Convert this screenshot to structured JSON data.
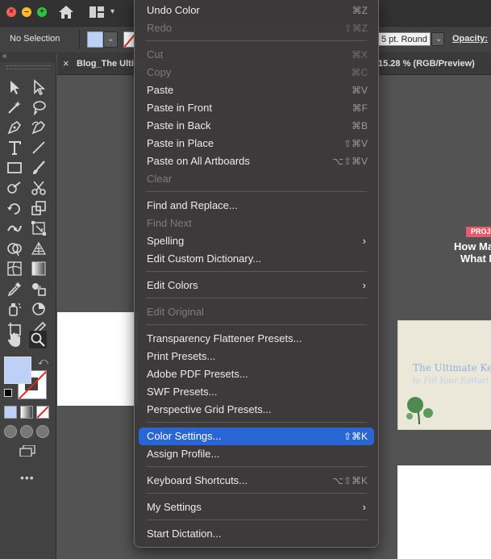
{
  "control_bar": {
    "no_selection": "No Selection",
    "stroke_profile": "5 pt. Round",
    "opacity_label": "Opacity:"
  },
  "colors": {
    "fill": "#bcd1f5",
    "stroke_none": "#e1261c",
    "highlight": "#2a65d4",
    "badge": "#e35d6a"
  },
  "document": {
    "tab_title": "Blog_The Ultim",
    "tab_title_right": "15.28 % (RGB/Preview)",
    "badge_text": "PROJE",
    "headline_line1": "How Ma",
    "headline_line2": "What M",
    "card_title": "The Ultimate Ke",
    "card_subtitle": "to Fill Your Editori"
  },
  "menu": {
    "items": [
      {
        "label": "Undo Color",
        "shortcut": "⌘Z",
        "disabled": false
      },
      {
        "label": "Redo",
        "shortcut": "⇧⌘Z",
        "disabled": true
      },
      {
        "label": "Cut",
        "shortcut": "⌘X",
        "disabled": true
      },
      {
        "label": "Copy",
        "shortcut": "⌘C",
        "disabled": true
      },
      {
        "label": "Paste",
        "shortcut": "⌘V",
        "disabled": false
      },
      {
        "label": "Paste in Front",
        "shortcut": "⌘F",
        "disabled": false
      },
      {
        "label": "Paste in Back",
        "shortcut": "⌘B",
        "disabled": false
      },
      {
        "label": "Paste in Place",
        "shortcut": "⇧⌘V",
        "disabled": false
      },
      {
        "label": "Paste on All Artboards",
        "shortcut": "⌥⇧⌘V",
        "disabled": false
      },
      {
        "label": "Clear",
        "shortcut": "",
        "disabled": true
      },
      {
        "label": "Find and Replace...",
        "shortcut": "",
        "disabled": false
      },
      {
        "label": "Find Next",
        "shortcut": "",
        "disabled": true
      },
      {
        "label": "Spelling",
        "shortcut": "",
        "disabled": false,
        "submenu": true
      },
      {
        "label": "Edit Custom Dictionary...",
        "shortcut": "",
        "disabled": false
      },
      {
        "label": "Edit Colors",
        "shortcut": "",
        "disabled": false,
        "submenu": true
      },
      {
        "label": "Edit Original",
        "shortcut": "",
        "disabled": true
      },
      {
        "label": "Transparency Flattener Presets...",
        "shortcut": "",
        "disabled": false
      },
      {
        "label": "Print Presets...",
        "shortcut": "",
        "disabled": false
      },
      {
        "label": "Adobe PDF Presets...",
        "shortcut": "",
        "disabled": false
      },
      {
        "label": "SWF Presets...",
        "shortcut": "",
        "disabled": false
      },
      {
        "label": "Perspective Grid Presets...",
        "shortcut": "",
        "disabled": false
      },
      {
        "label": "Color Settings...",
        "shortcut": "⇧⌘K",
        "disabled": false,
        "highlighted": true
      },
      {
        "label": "Assign Profile...",
        "shortcut": "",
        "disabled": false
      },
      {
        "label": "Keyboard Shortcuts...",
        "shortcut": "⌥⇧⌘K",
        "disabled": false
      },
      {
        "label": "My Settings",
        "shortcut": "",
        "disabled": false,
        "submenu": true
      },
      {
        "label": "Start Dictation...",
        "shortcut": "",
        "disabled": false
      }
    ]
  }
}
